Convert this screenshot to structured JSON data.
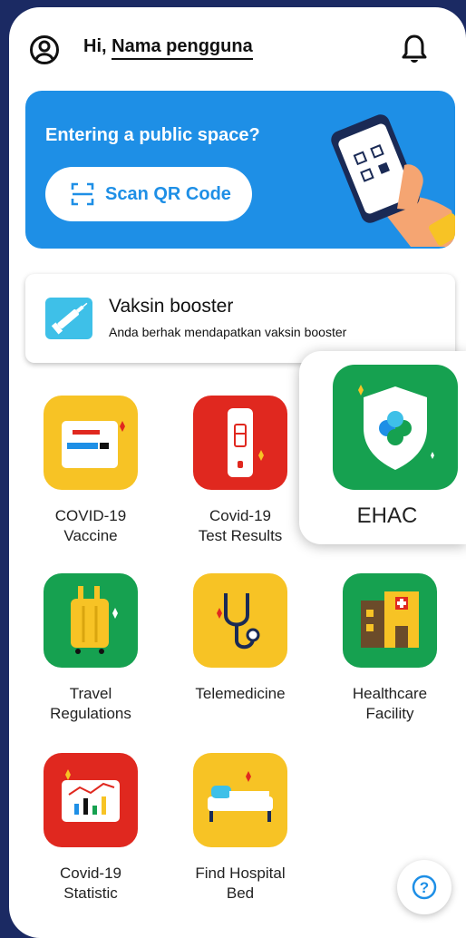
{
  "header": {
    "greeting": "Hi,",
    "user_name": "Nama pengguna"
  },
  "banner": {
    "title": "Entering a public space?",
    "scan_label": "Scan QR Code"
  },
  "vaksin": {
    "title": "Vaksin booster",
    "subtitle": "Anda berhak mendapatkan vaksin booster"
  },
  "menu": {
    "items": [
      {
        "line1": "COVID-19",
        "line2": "Vaccine"
      },
      {
        "line1": "Covid-19",
        "line2": "Test Results"
      },
      {
        "line1": "EHAC",
        "line2": ""
      },
      {
        "line1": "Travel",
        "line2": "Regulations"
      },
      {
        "line1": "Telemedicine",
        "line2": ""
      },
      {
        "line1": "Healthcare",
        "line2": "Facility"
      },
      {
        "line1": "Covid-19",
        "line2": "Statistic"
      },
      {
        "line1": "Find Hospital",
        "line2": "Bed"
      }
    ]
  },
  "colors": {
    "blue": "#1e8fe6",
    "yellow": "#f7c325",
    "red": "#e0281f",
    "green": "#16a150",
    "navy": "#1b2a63"
  }
}
